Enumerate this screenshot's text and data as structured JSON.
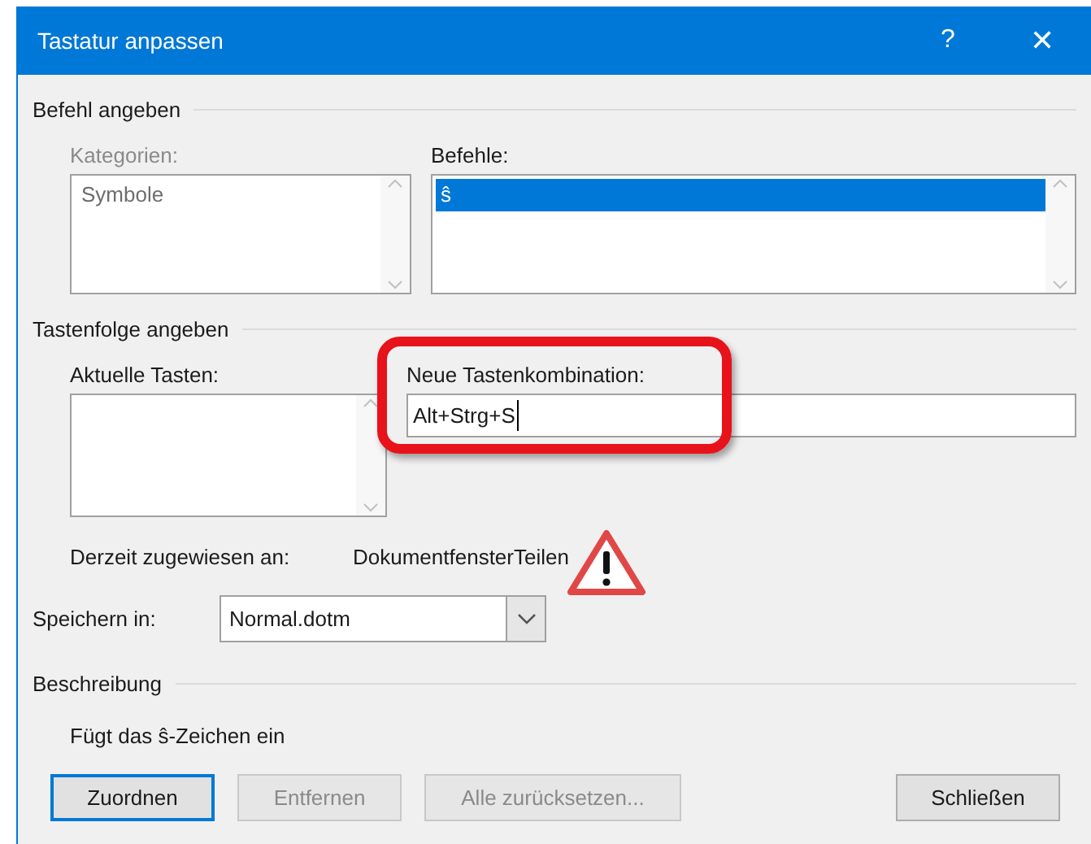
{
  "window": {
    "title": "Tastatur anpassen",
    "help": "?",
    "close": "✕"
  },
  "command_group": {
    "title": "Befehl angeben",
    "categories": {
      "label": "Kategorien:",
      "disabled": true,
      "items": [
        {
          "label": "Symbole",
          "selected": false
        }
      ]
    },
    "commands": {
      "label": "Befehle:",
      "disabled": false,
      "items": [
        {
          "label": "ŝ",
          "selected": true
        }
      ]
    }
  },
  "keys_group": {
    "title": "Tastenfolge angeben",
    "current_keys": {
      "label": "Aktuelle Tasten:"
    },
    "new_shortcut": {
      "label": "Neue Tastenkombination:",
      "value": "Alt+Strg+S",
      "highlighted": true
    },
    "assigned_label": "Derzeit zugewiesen an:",
    "assigned_value": "DokumentfensterTeilen",
    "warning": true
  },
  "save_in": {
    "label": "Speichern in:",
    "value": "Normal.dotm"
  },
  "description": {
    "title": "Beschreibung",
    "text": "Fügt das ŝ-Zeichen ein"
  },
  "buttons": [
    {
      "label": "Zuordnen",
      "disabled": false,
      "default": true
    },
    {
      "label": "Entfernen",
      "disabled": true,
      "default": false
    },
    {
      "label": "Alle zurücksetzen...",
      "disabled": true,
      "default": false
    },
    {
      "label": "Schließen",
      "disabled": false,
      "default": false
    }
  ]
}
